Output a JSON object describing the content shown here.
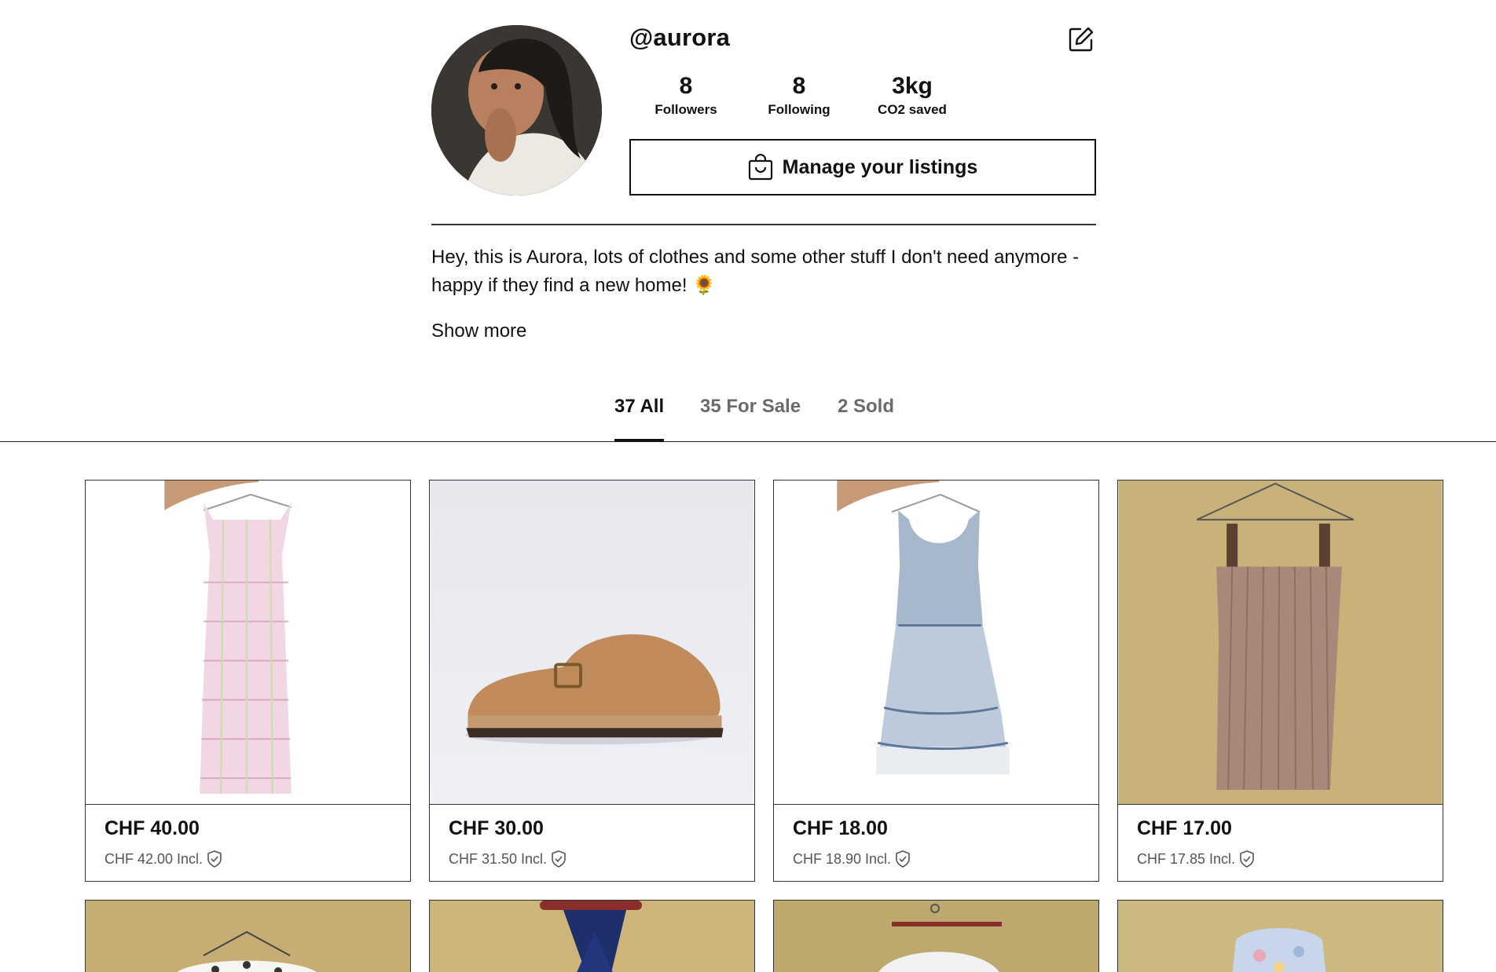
{
  "profile": {
    "username": "@aurora",
    "stats": [
      {
        "value": "8",
        "label": "Followers"
      },
      {
        "value": "8",
        "label": "Following"
      },
      {
        "value": "3kg",
        "label": "CO2 saved"
      }
    ],
    "manage_label": "Manage your listings",
    "bio": "Hey, this is Aurora, lots of clothes and some other stuff I don't need anymore - happy if they find a new home! 🌻",
    "show_more": "Show more"
  },
  "tabs": [
    {
      "label": "37 All",
      "active": true
    },
    {
      "label": "35 For Sale",
      "active": false
    },
    {
      "label": "2 Sold",
      "active": false
    }
  ],
  "listings": [
    {
      "price": "CHF 40.00",
      "incl": "CHF 42.00 Incl."
    },
    {
      "price": "CHF 30.00",
      "incl": "CHF 31.50 Incl."
    },
    {
      "price": "CHF 18.00",
      "incl": "CHF 18.90 Incl."
    },
    {
      "price": "CHF 17.00",
      "incl": "CHF 17.85 Incl."
    }
  ]
}
